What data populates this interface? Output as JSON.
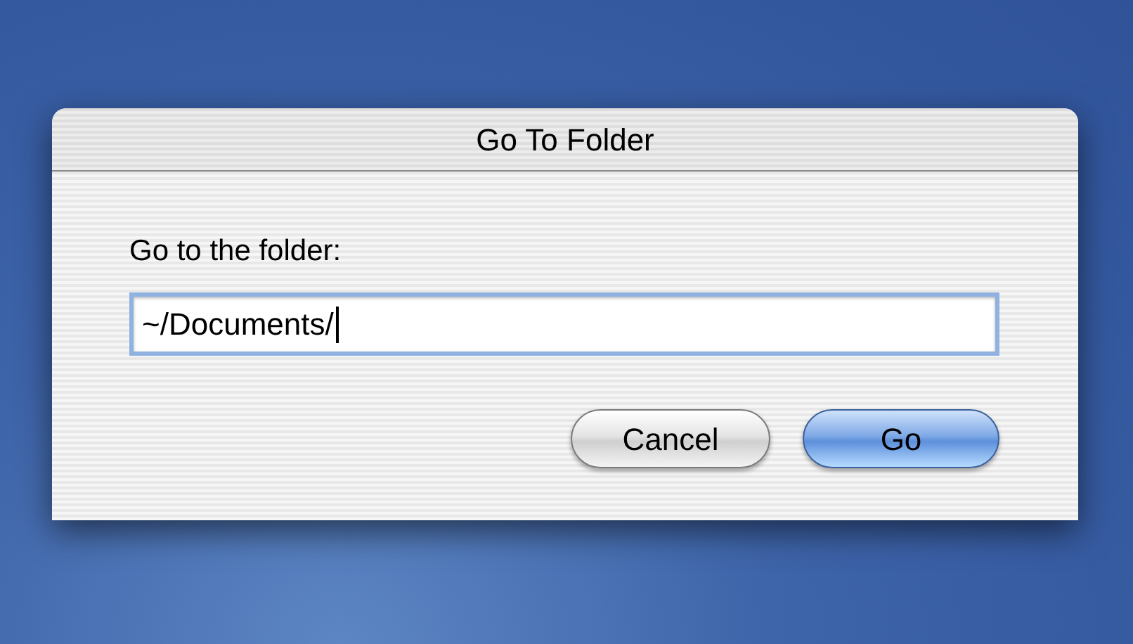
{
  "window": {
    "title": "Go To Folder"
  },
  "prompt": "Go to the folder:",
  "path_field": {
    "value": "~/Documents/",
    "focused": true
  },
  "buttons": [
    {
      "label": "Cancel",
      "default": false
    },
    {
      "label": "Go",
      "default": true
    }
  ]
}
